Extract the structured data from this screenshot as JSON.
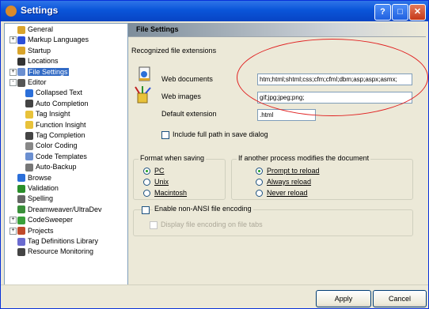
{
  "window": {
    "title": "Settings"
  },
  "tree": {
    "items": [
      {
        "label": "General",
        "indent": 0,
        "expander": "",
        "icon_color": "#d9a42b",
        "selected": false
      },
      {
        "label": "Markup Languages",
        "indent": 0,
        "expander": "+",
        "icon_color": "#2b4fd9",
        "selected": false
      },
      {
        "label": "Startup",
        "indent": 0,
        "expander": "",
        "icon_color": "#d9a42b",
        "selected": false
      },
      {
        "label": "Locations",
        "indent": 0,
        "expander": "",
        "icon_color": "#333333",
        "selected": false
      },
      {
        "label": "File Settings",
        "indent": 0,
        "expander": "+",
        "icon_color": "#6b8fd0",
        "selected": true
      },
      {
        "label": "Editor",
        "indent": 0,
        "expander": "-",
        "icon_color": "#555555",
        "selected": false
      },
      {
        "label": "Collapsed Text",
        "indent": 1,
        "expander": "",
        "icon_color": "#2b6fd9",
        "selected": false
      },
      {
        "label": "Auto Completion",
        "indent": 1,
        "expander": "",
        "icon_color": "#444444",
        "selected": false
      },
      {
        "label": "Tag Insight",
        "indent": 1,
        "expander": "",
        "icon_color": "#e8c23a",
        "selected": false
      },
      {
        "label": "Function Insight",
        "indent": 1,
        "expander": "",
        "icon_color": "#e8c23a",
        "selected": false
      },
      {
        "label": "Tag Completion",
        "indent": 1,
        "expander": "",
        "icon_color": "#444444",
        "selected": false
      },
      {
        "label": "Color Coding",
        "indent": 1,
        "expander": "",
        "icon_color": "#888888",
        "selected": false
      },
      {
        "label": "Code Templates",
        "indent": 1,
        "expander": "",
        "icon_color": "#6b8fd0",
        "selected": false
      },
      {
        "label": "Auto-Backup",
        "indent": 1,
        "expander": "",
        "icon_color": "#777777",
        "selected": false
      },
      {
        "label": "Browse",
        "indent": 0,
        "expander": "",
        "icon_color": "#2b6fd9",
        "selected": false
      },
      {
        "label": "Validation",
        "indent": 0,
        "expander": "",
        "icon_color": "#2b8f2b",
        "selected": false
      },
      {
        "label": "Spelling",
        "indent": 0,
        "expander": "",
        "icon_color": "#666666",
        "selected": false
      },
      {
        "label": "Dreamweaver/UltraDev",
        "indent": 0,
        "expander": "",
        "icon_color": "#3a8f3a",
        "selected": false
      },
      {
        "label": "CodeSweeper",
        "indent": 0,
        "expander": "+",
        "icon_color": "#3aa03a",
        "selected": false
      },
      {
        "label": "Projects",
        "indent": 0,
        "expander": "+",
        "icon_color": "#c04a2b",
        "selected": false
      },
      {
        "label": "Tag Definitions Library",
        "indent": 0,
        "expander": "",
        "icon_color": "#6b6bd0",
        "selected": false
      },
      {
        "label": "Resource Monitoring",
        "indent": 0,
        "expander": "",
        "icon_color": "#444444",
        "selected": false
      }
    ]
  },
  "panel": {
    "header": "File Settings",
    "recognized_label": "Recognized file extensions",
    "web_documents_label": "Web documents",
    "web_documents_value": "htm;html;shtml;css;cfm;cfml;dbm;asp;aspx;asmx;",
    "web_images_label": "Web images",
    "web_images_value": "gif;jpg;jpeg;png;",
    "default_ext_label": "Default extension",
    "default_ext_value": ".html",
    "include_full_path_label": "Include full path in save dialog",
    "format_group": {
      "legend": "Format when saving",
      "options": [
        "PC",
        "Unix",
        "Macintosh"
      ],
      "selected": 0
    },
    "process_group": {
      "legend": "If another process modifies the document",
      "options": [
        "Prompt to reload",
        "Always reload",
        "Never reload"
      ],
      "selected": 0
    },
    "enable_ansi_label": "Enable non-ANSI file encoding",
    "display_encoding_label": "Display file encoding on file tabs"
  },
  "buttons": {
    "apply": "Apply",
    "cancel": "Cancel"
  },
  "colors": {
    "selection": "#316ac5",
    "annotation": "#e02020",
    "titlebar": "#0a55d9"
  }
}
